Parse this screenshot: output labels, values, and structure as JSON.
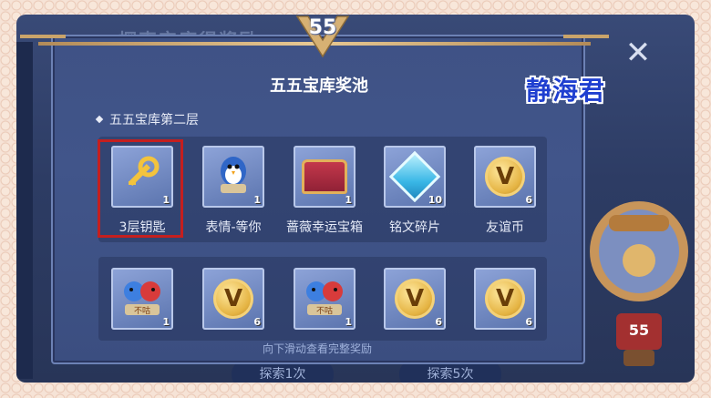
{
  "background": {
    "header_text": "探索宝库得奖励…",
    "buttons": [
      {
        "label": "探索1次"
      },
      {
        "label": "探索5次"
      }
    ]
  },
  "panel": {
    "title": "五五宝库奖池",
    "badge_number": "55",
    "section_label": "五五宝库第二层",
    "hint": "向下滑动查看完整奖励",
    "row1": [
      {
        "name": "3层钥匙",
        "count": "1",
        "icon": "golden-key-icon",
        "highlighted": true
      },
      {
        "name": "表情-等你",
        "count": "1",
        "icon": "penguin-emote-icon"
      },
      {
        "name": "蔷薇幸运宝箱",
        "count": "1",
        "icon": "treasure-chest-icon"
      },
      {
        "name": "铭文碎片",
        "count": "10",
        "icon": "crystal-icon"
      },
      {
        "name": "友谊币",
        "count": "6",
        "icon": "friendship-coin-icon"
      }
    ],
    "row2": [
      {
        "count": "1",
        "icon": "bird-emote-icon",
        "tag": "不咕"
      },
      {
        "count": "6",
        "icon": "friendship-coin-icon"
      },
      {
        "count": "1",
        "icon": "bird-emote-icon",
        "tag": "不咕"
      },
      {
        "count": "6",
        "icon": "friendship-coin-icon"
      },
      {
        "count": "6",
        "icon": "friendship-coin-icon"
      }
    ]
  },
  "watermark": "静海君",
  "side": {
    "balloon_badge": "55"
  },
  "colors": {
    "highlight": "#c41f1f",
    "watermark": "#1f3fd0",
    "panel": "#41558a"
  }
}
